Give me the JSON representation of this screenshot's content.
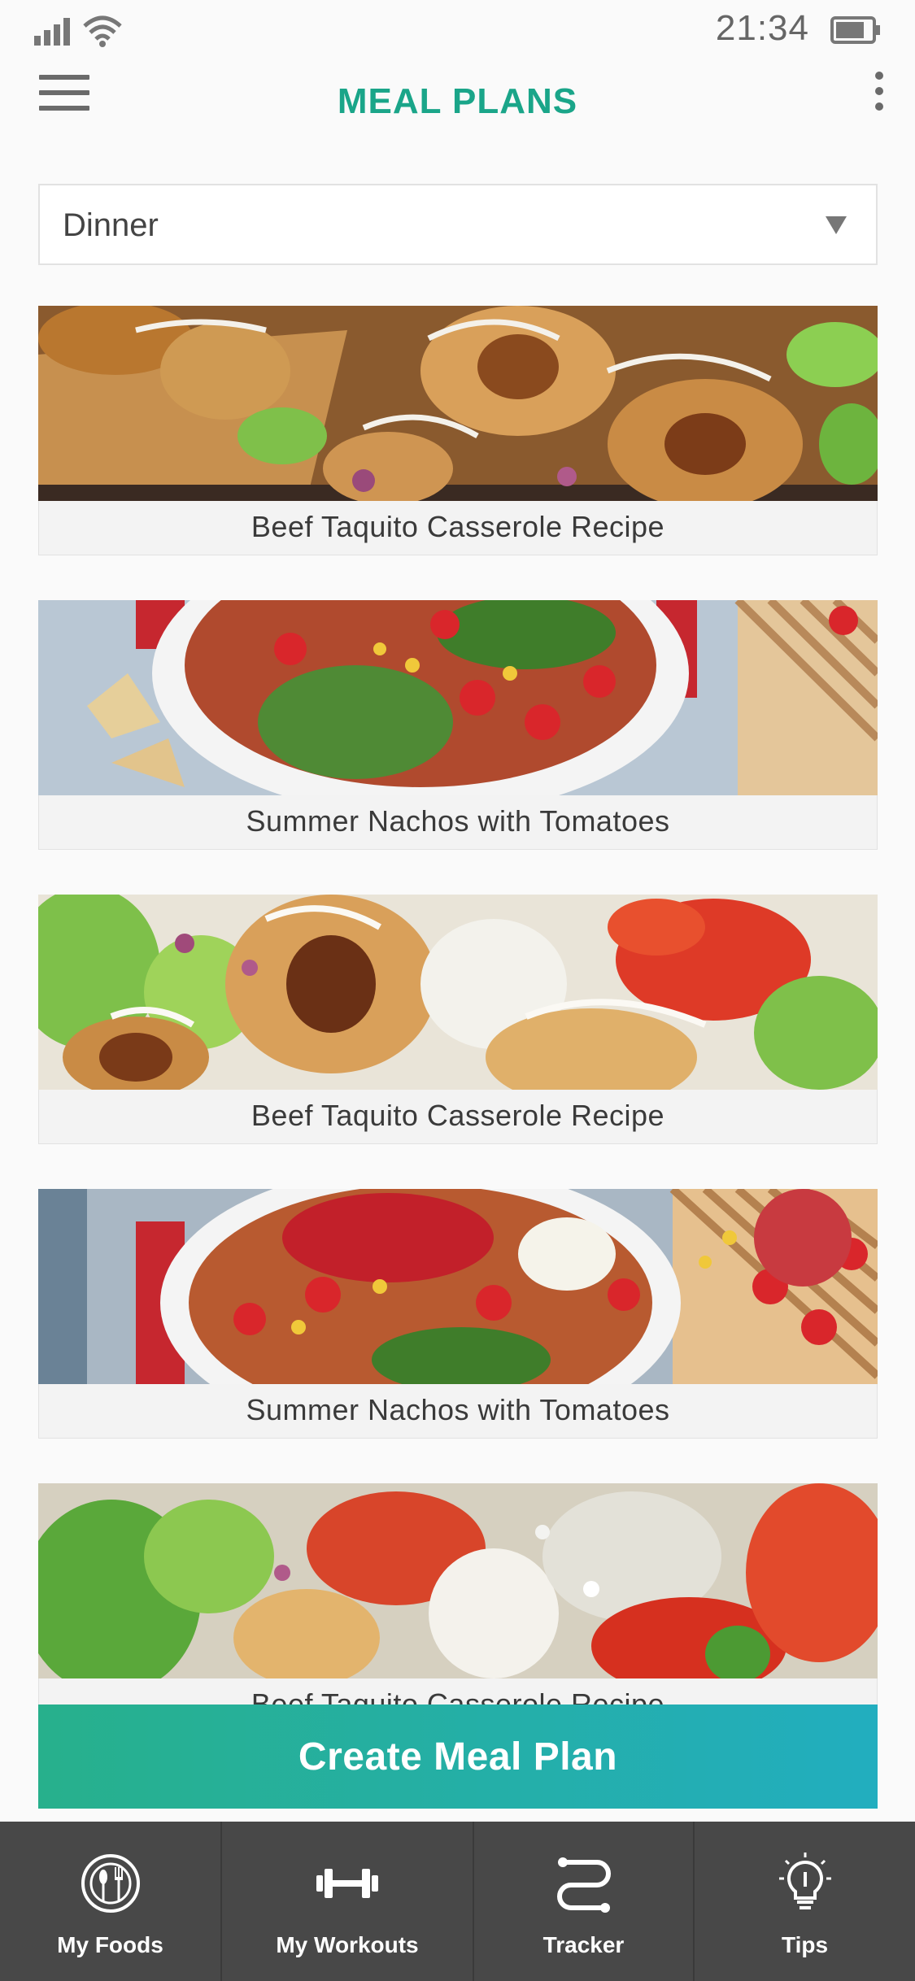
{
  "status_bar": {
    "time": "21:34"
  },
  "header": {
    "title": "MEAL PLANS"
  },
  "filter": {
    "selected": "Dinner"
  },
  "recipes": [
    {
      "title": "Beef Taquito Casserole Recipe",
      "image": "taquito-photo"
    },
    {
      "title": "Summer Nachos with Tomatoes",
      "image": "nachos-photo"
    },
    {
      "title": "Beef Taquito Casserole Recipe",
      "image": "taquito-photo"
    },
    {
      "title": "Summer Nachos with Tomatoes",
      "image": "nachos-photo"
    },
    {
      "title": "Beef Taquito Casserole Recipe",
      "image": "salad-photo"
    }
  ],
  "cta": {
    "label": "Create Meal Plan"
  },
  "bottom_nav": [
    {
      "label": "My Foods",
      "icon": "plate-utensils-icon"
    },
    {
      "label": "My Workouts",
      "icon": "dumbbell-icon"
    },
    {
      "label": "Tracker",
      "icon": "route-icon"
    },
    {
      "label": "Tips",
      "icon": "lightbulb-icon"
    }
  ],
  "colors": {
    "accent": "#1aa589",
    "cta_start": "#27b08c",
    "cta_end": "#22aebf",
    "nav_bg": "#484848"
  }
}
